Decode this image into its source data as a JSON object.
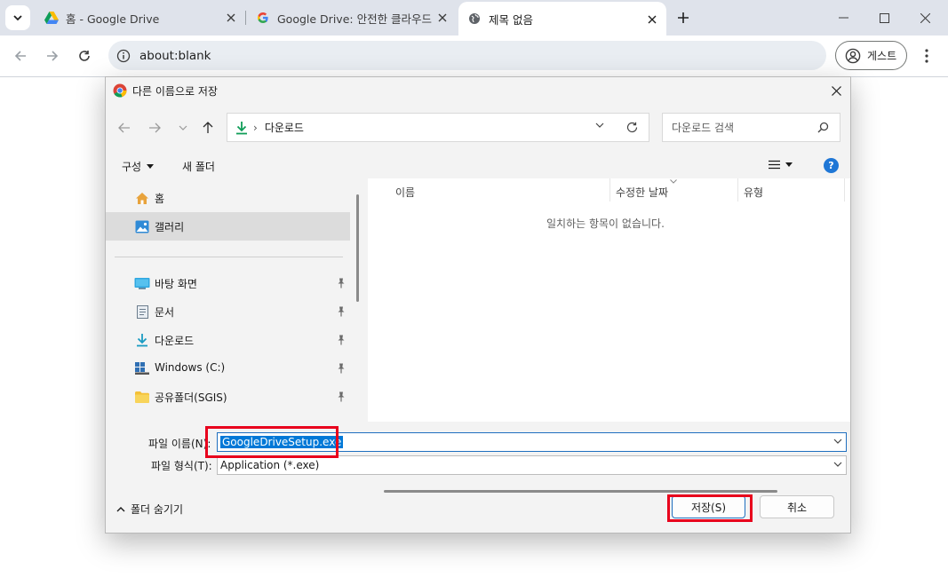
{
  "browser": {
    "tabs": [
      {
        "title": "홈 - Google Drive",
        "active": false
      },
      {
        "title": "Google Drive: 안전한 클라우드",
        "active": false
      },
      {
        "title": "제목 없음",
        "active": true
      }
    ],
    "address_url": "about:blank",
    "profile_label": "게스트"
  },
  "dialog": {
    "title": "다른 이름으로 저장",
    "breadcrumb_root": "다운로드",
    "search_placeholder": "다운로드 검색",
    "organize_label": "구성",
    "new_folder_label": "새 폴더",
    "help_label": "?",
    "nav_items": [
      {
        "label": "홈",
        "icon": "home-icon",
        "selected": false,
        "pinned": false
      },
      {
        "label": "갤러리",
        "icon": "gallery-icon",
        "selected": true,
        "pinned": false
      },
      {
        "label": "바탕 화면",
        "icon": "desktop-icon",
        "selected": false,
        "pinned": true
      },
      {
        "label": "문서",
        "icon": "documents-icon",
        "selected": false,
        "pinned": true
      },
      {
        "label": "다운로드",
        "icon": "download-icon",
        "selected": false,
        "pinned": true
      },
      {
        "label": "Windows (C:)",
        "icon": "drive-icon",
        "selected": false,
        "pinned": true
      },
      {
        "label": "공유폴더(SGIS)",
        "icon": "folder-icon",
        "selected": false,
        "pinned": true
      }
    ],
    "columns": [
      "이름",
      "수정한 날짜",
      "유형"
    ],
    "empty_message": "일치하는 항목이 없습니다.",
    "filename_label": "파일 이름(N):",
    "filename_value": "GoogleDriveSetup.exe",
    "filetype_label": "파일 형식(T):",
    "filetype_value": "Application (*.exe)",
    "hide_folders_label": "폴더 숨기기",
    "save_label": "저장(S)",
    "cancel_label": "취소"
  },
  "highlight_color": "#e8001c",
  "accent_color": "#0078d7"
}
